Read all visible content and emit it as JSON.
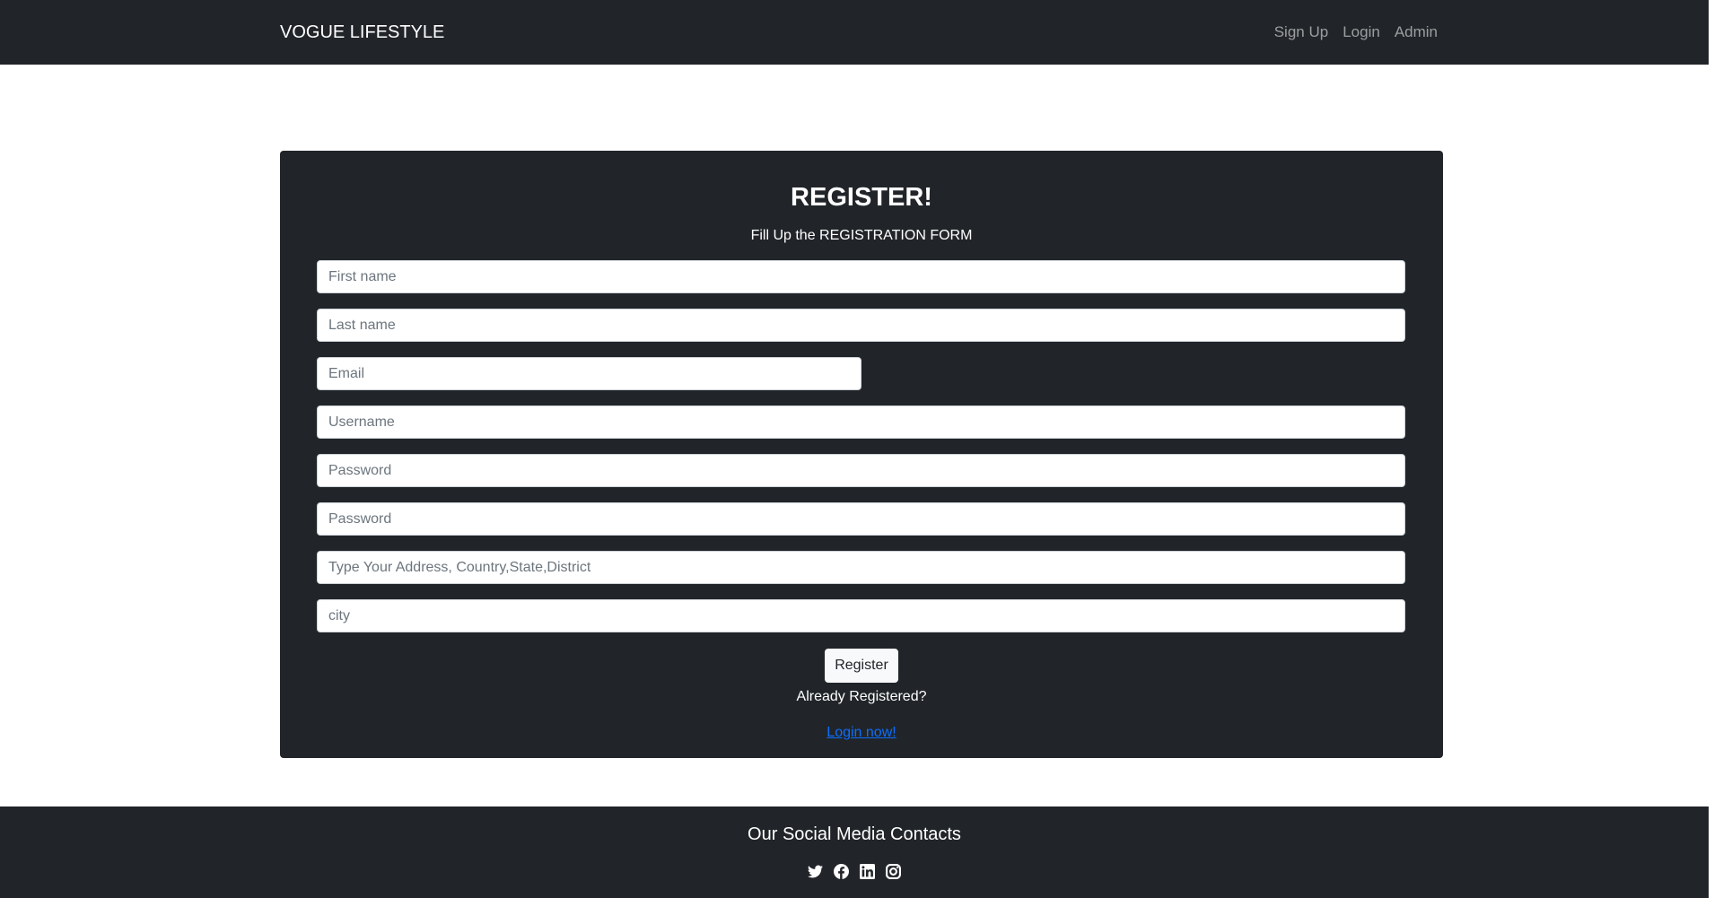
{
  "navbar": {
    "brand": "VOGUE LIFESTYLE",
    "links": [
      "Sign Up",
      "Login",
      "Admin"
    ]
  },
  "form": {
    "title": "REGISTER!",
    "subtitle": "Fill Up the REGISTRATION FORM",
    "fields": {
      "first_name": {
        "placeholder": "First name",
        "value": ""
      },
      "last_name": {
        "placeholder": "Last name",
        "value": ""
      },
      "email": {
        "placeholder": "Email",
        "value": ""
      },
      "username": {
        "placeholder": "Username",
        "value": ""
      },
      "password": {
        "placeholder": "Password",
        "value": ""
      },
      "confirm_password": {
        "placeholder": "Password",
        "value": ""
      },
      "address": {
        "placeholder": "Type Your Address, Country,State,District",
        "value": ""
      },
      "city": {
        "placeholder": "city",
        "value": ""
      }
    },
    "submit_label": "Register",
    "already_text": "Already Registered?",
    "login_link": "Login now!"
  },
  "footer": {
    "title": "Our Social Media Contacts",
    "icons": [
      "twitter-icon",
      "facebook-icon",
      "linkedin-icon",
      "instagram-icon"
    ]
  },
  "colors": {
    "dark": "#212529",
    "link": "#0d6efd",
    "nav_link": "rgba(255,255,255,0.55)"
  }
}
